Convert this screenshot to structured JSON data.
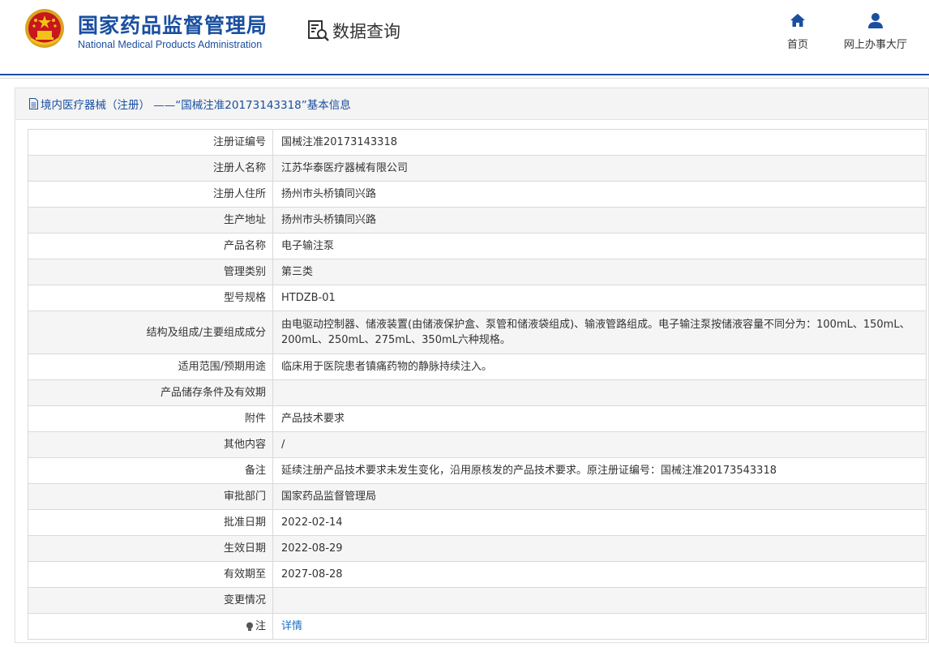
{
  "header": {
    "org_name_cn": "国家药品监督管理局",
    "org_name_en": "National Medical Products Administration",
    "query_title": "数据查询",
    "nav": [
      {
        "label": "首页",
        "icon": "home-icon"
      },
      {
        "label": "网上办事大厅",
        "icon": "user-icon"
      }
    ]
  },
  "panel": {
    "title": "境内医疗器械（注册） ——“国械注准20173143318”基本信息"
  },
  "rows": [
    {
      "key": "注册证编号",
      "value": "国械注准20173143318"
    },
    {
      "key": "注册人名称",
      "value": "江苏华泰医疗器械有限公司"
    },
    {
      "key": "注册人住所",
      "value": "扬州市头桥镇同兴路"
    },
    {
      "key": "生产地址",
      "value": "扬州市头桥镇同兴路"
    },
    {
      "key": "产品名称",
      "value": "电子输注泵"
    },
    {
      "key": "管理类别",
      "value": "第三类"
    },
    {
      "key": "型号规格",
      "value": "HTDZB-01"
    },
    {
      "key": "结构及组成/主要组成成分",
      "value": "由电驱动控制器、储液装置(由储液保护盒、泵管和储液袋组成)、输液管路组成。电子输注泵按储液容量不同分为：100mL、150mL、200mL、250mL、275mL、350mL六种规格。"
    },
    {
      "key": "适用范围/预期用途",
      "value": "临床用于医院患者镇痛药物的静脉持续注入。"
    },
    {
      "key": "产品储存条件及有效期",
      "value": ""
    },
    {
      "key": "附件",
      "value": "产品技术要求"
    },
    {
      "key": "其他内容",
      "value": "/"
    },
    {
      "key": "备注",
      "value": "延续注册产品技术要求未发生变化，沿用原核发的产品技术要求。原注册证编号：国械注准20173543318"
    },
    {
      "key": "审批部门",
      "value": "国家药品监督管理局"
    },
    {
      "key": "批准日期",
      "value": "2022-02-14"
    },
    {
      "key": "生效日期",
      "value": "2022-08-29"
    },
    {
      "key": "有效期至",
      "value": "2027-08-28"
    },
    {
      "key": "变更情况",
      "value": ""
    },
    {
      "key": "注",
      "value": "详情"
    }
  ],
  "colors": {
    "brand_blue": "#1a4fa0",
    "link_blue": "#1a6fc4",
    "stripe": "#f5f5f5"
  }
}
